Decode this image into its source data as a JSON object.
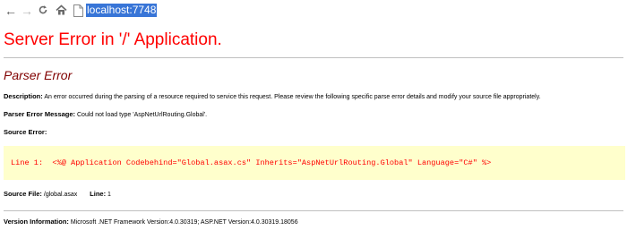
{
  "browser": {
    "url": "localhost:7748",
    "icons": {
      "back": "arrow-left-icon",
      "forward": "arrow-right-icon",
      "reload": "reload-icon",
      "home": "home-icon",
      "page": "page-icon"
    }
  },
  "error": {
    "title": "Server Error in '/' Application.",
    "subtitle": "Parser Error",
    "description_label": "Description:",
    "description_text": "An error occurred during the parsing of a resource required to service this request. Please review the following specific parse error details and modify your source file appropriately.",
    "message_label": "Parser Error Message:",
    "message_text": "Could not load type 'AspNetUrlRouting.Global'.",
    "source_error_label": "Source Error:",
    "code_line": "Line 1:  <%@ Application Codebehind=\"Global.asax.cs\" Inherits=\"AspNetUrlRouting.Global\" Language=\"C#\" %>",
    "source_file_label": "Source File:",
    "source_file_value": "/global.asax",
    "line_label": "Line:",
    "line_value": "1",
    "version_label": "Version Information:",
    "version_text": "Microsoft .NET Framework Version:4.0.30319; ASP.NET Version:4.0.30319.18056"
  },
  "colors": {
    "title": "#ff0000",
    "subtitle": "#800000",
    "code_background": "#ffffcc",
    "code_text": "#ff0000",
    "url_highlight": "#3875d7"
  }
}
